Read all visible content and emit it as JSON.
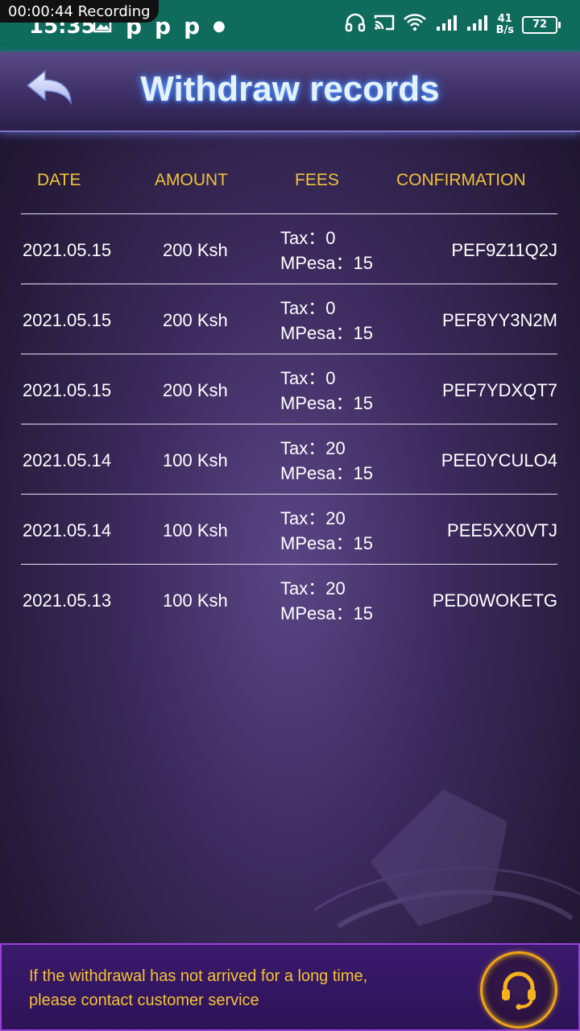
{
  "status_bar": {
    "recording_label": "00:00:44  Recording",
    "time": "15:35",
    "net_speed_value": "41",
    "net_speed_unit": "B/s",
    "battery": "72"
  },
  "header": {
    "title": "Withdraw records",
    "back_icon": "back-arrow-icon"
  },
  "table": {
    "columns": [
      "DATE",
      "AMOUNT",
      "FEES",
      "CONFIRMATION"
    ],
    "rows": [
      {
        "date": "2021.05.15",
        "amount": "200 Ksh",
        "tax": "Tax：0",
        "mpesa": "MPesa：15",
        "confirmation": "PEF9Z11Q2J"
      },
      {
        "date": "2021.05.15",
        "amount": "200 Ksh",
        "tax": "Tax：0",
        "mpesa": "MPesa：15",
        "confirmation": "PEF8YY3N2M"
      },
      {
        "date": "2021.05.15",
        "amount": "200 Ksh",
        "tax": "Tax：0",
        "mpesa": "MPesa：15",
        "confirmation": "PEF7YDXQT7"
      },
      {
        "date": "2021.05.14",
        "amount": "100 Ksh",
        "tax": "Tax：20",
        "mpesa": "MPesa：15",
        "confirmation": "PEE0YCULO4"
      },
      {
        "date": "2021.05.14",
        "amount": "100 Ksh",
        "tax": "Tax：20",
        "mpesa": "MPesa：15",
        "confirmation": "PEE5XX0VTJ"
      },
      {
        "date": "2021.05.13",
        "amount": "100 Ksh",
        "tax": "Tax：20",
        "mpesa": "MPesa：15",
        "confirmation": "PED0WOKETG"
      }
    ]
  },
  "footer": {
    "message_line1": "If the withdrawal has not arrived for a long time,",
    "message_line2": "please contact customer service",
    "support_icon": "headset-icon"
  },
  "colors": {
    "status_bar_bg": "#0f6b5c",
    "header_accent": "#e6f1ff",
    "column_header": "#f0c23a",
    "footer_text": "#f5c235",
    "footer_border": "#9b3fd9"
  }
}
